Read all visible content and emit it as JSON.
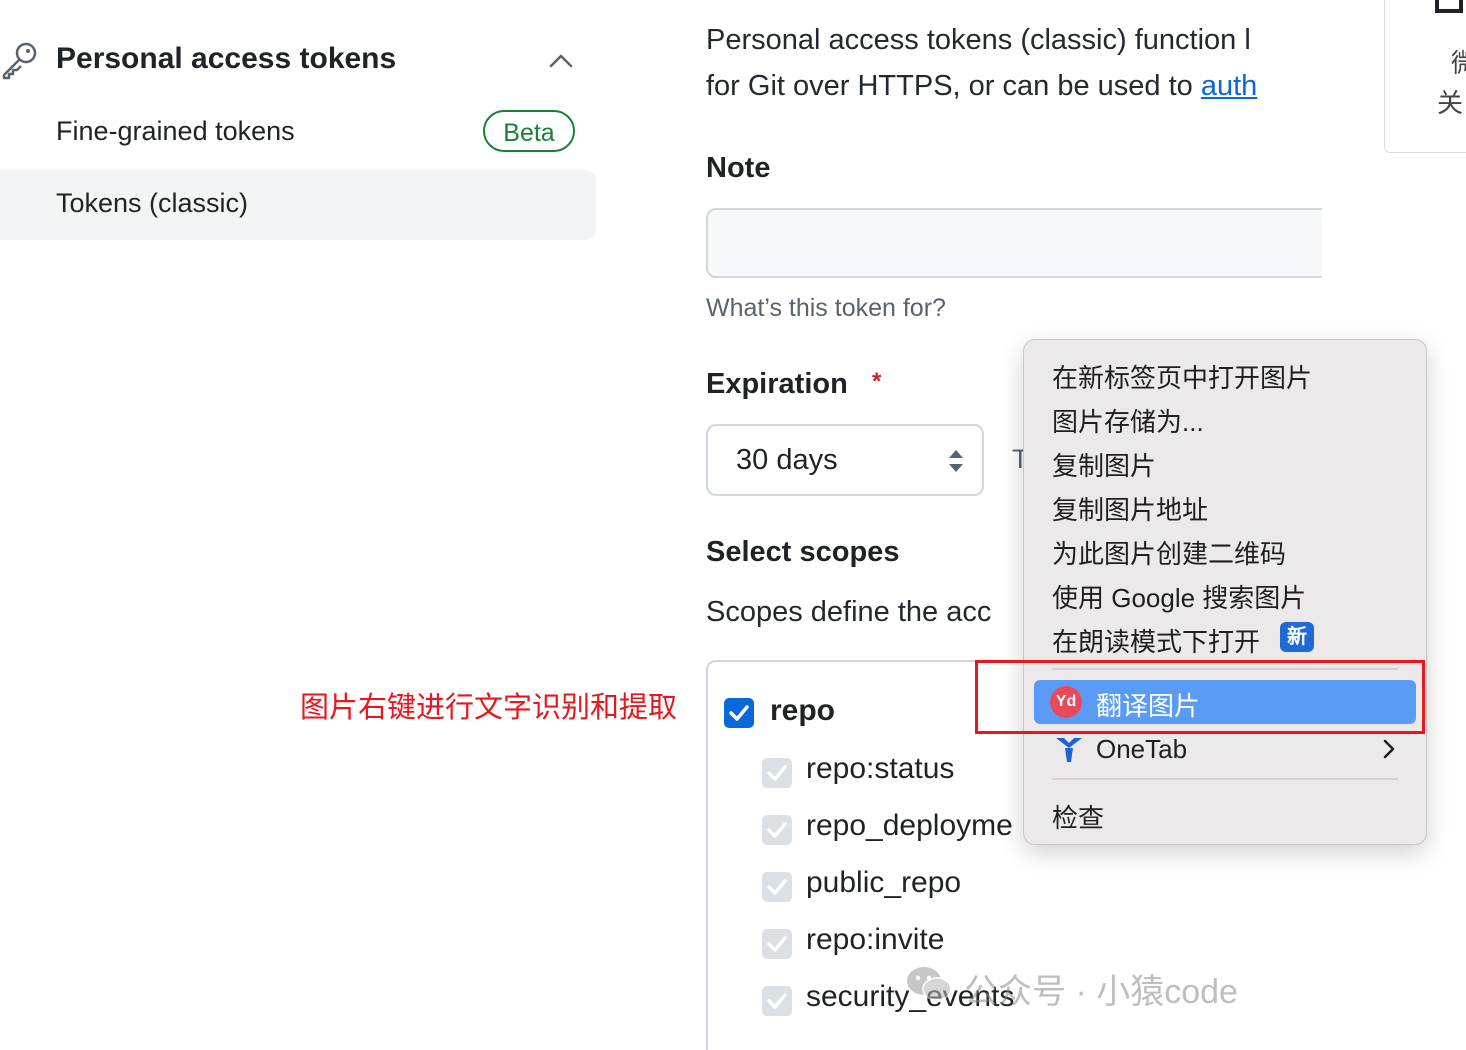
{
  "sidebar": {
    "title": "Personal access tokens",
    "items": [
      {
        "label": "Fine-grained tokens",
        "badge": "Beta"
      },
      {
        "label": "Tokens (classic)"
      }
    ]
  },
  "main": {
    "description_line1": "Personal access tokens (classic) function l",
    "description_line2_prefix": "for Git over HTTPS, or can be used to ",
    "description_line2_link": "auth",
    "note": {
      "label": "Note",
      "value": "",
      "hint": "What’s this token for?"
    },
    "expiration": {
      "label": "Expiration",
      "required_mark": "*",
      "selected": "30 days",
      "trailing_text": "T"
    },
    "scopes": {
      "label": "Select scopes",
      "description": "Scopes define the acc",
      "parent": {
        "label": "repo",
        "checked": true
      },
      "children": [
        {
          "label": "repo:status",
          "checked": true
        },
        {
          "label": "repo_deployme",
          "checked": true
        },
        {
          "label": "public_repo",
          "checked": true
        },
        {
          "label": "repo:invite",
          "checked": true
        },
        {
          "label": "security_events",
          "checked": true
        }
      ]
    }
  },
  "right_panel": {
    "text1": "微",
    "text2": "关"
  },
  "annotation": {
    "text": "图片右键进行文字识别和提取",
    "color": "#e8161d"
  },
  "context_menu": {
    "items": [
      "在新标签页中打开图片",
      "图片存储为...",
      "复制图片",
      "复制图片地址",
      "为此图片创建二维码",
      "使用 Google 搜索图片",
      "在朗读模式下打开"
    ],
    "new_badge": "新",
    "highlighted_item": {
      "label": "翻译图片",
      "icon_text": "Yd"
    },
    "onetab": "OneTab",
    "inspect": "检查",
    "highlight_color": "#5a9cf5"
  },
  "watermark": {
    "text": "公众号 · 小猿code"
  }
}
